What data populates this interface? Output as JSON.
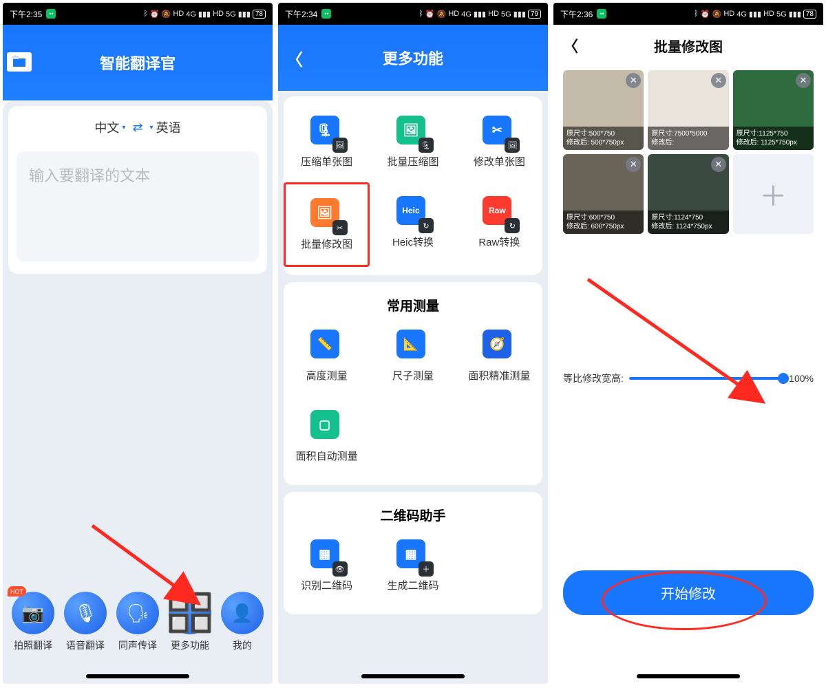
{
  "screen1": {
    "status_time": "下午2:35",
    "battery": "78",
    "title": "智能翻译官",
    "lang_from": "中文",
    "lang_to": "英语",
    "input_placeholder": "输入要翻译的文本",
    "hot_label": "HOT",
    "tabs": [
      {
        "label": "拍照翻译",
        "glyph": "📷"
      },
      {
        "label": "语音翻译",
        "glyph": "🎤"
      },
      {
        "label": "同声传译",
        "glyph": "👤)"
      },
      {
        "label": "更多功能",
        "glyph": "⬛⬛"
      },
      {
        "label": "我的",
        "glyph": "👤"
      }
    ]
  },
  "screen2": {
    "status_time": "下午2:34",
    "battery": "79",
    "title": "更多功能",
    "section2_title": "常用测量",
    "section3_title": "二维码助手",
    "grid1": [
      {
        "label": "压缩单张图",
        "bg": "#1976ff",
        "glyph": "🗜",
        "sub": "🖼"
      },
      {
        "label": "批量压缩图",
        "bg": "#14c08b",
        "glyph": "🖼",
        "sub": "🗜"
      },
      {
        "label": "修改单张图",
        "bg": "#1976ff",
        "glyph": "✂",
        "sub": "🖼"
      },
      {
        "label": "批量修改图",
        "bg": "#ff7a2e",
        "glyph": "🖼",
        "sub": "✂"
      },
      {
        "label": "Heic转换",
        "bg": "#1976ff",
        "glyph": "Heic",
        "sub": "↻"
      },
      {
        "label": "Raw转换",
        "bg": "#ff3b30",
        "glyph": "Raw",
        "sub": "↻"
      }
    ],
    "grid2": [
      {
        "label": "高度测量",
        "bg": "#1976ff",
        "glyph": "📏"
      },
      {
        "label": "尺子测量",
        "bg": "#1976ff",
        "glyph": "📐"
      },
      {
        "label": "面积精准测量",
        "bg": "#1e62e8",
        "glyph": "🧭"
      },
      {
        "label": "面积自动测量",
        "bg": "#14c08b",
        "glyph": "▢"
      }
    ],
    "grid3": [
      {
        "label": "识别二维码",
        "bg": "#1976ff",
        "glyph": "▦",
        "sub": "👁"
      },
      {
        "label": "生成二维码",
        "bg": "#1976ff",
        "glyph": "▦",
        "sub": "＋"
      }
    ]
  },
  "screen3": {
    "status_time": "下午2:36",
    "battery": "78",
    "title": "批量修改图",
    "slider_label": "等比修改宽高:",
    "slider_value": "100%",
    "start_label": "开始修改",
    "thumbs": [
      {
        "orig": "原尺寸:500*750",
        "after": "修改后: 500*750px",
        "bg": "#c4bca8"
      },
      {
        "orig": "原尺寸:7500*5000",
        "after": "修改后:",
        "bg": "#e8e3db"
      },
      {
        "orig": "原尺寸:1125*750",
        "after": "修改后: 1125*750px",
        "bg": "#2e6b3d"
      },
      {
        "orig": "原尺寸:600*750",
        "after": "修改后: 600*750px",
        "bg": "#6a6358"
      },
      {
        "orig": "原尺寸:1124*750",
        "after": "修改后: 1124*750px",
        "bg": "#3b4a40"
      }
    ]
  }
}
